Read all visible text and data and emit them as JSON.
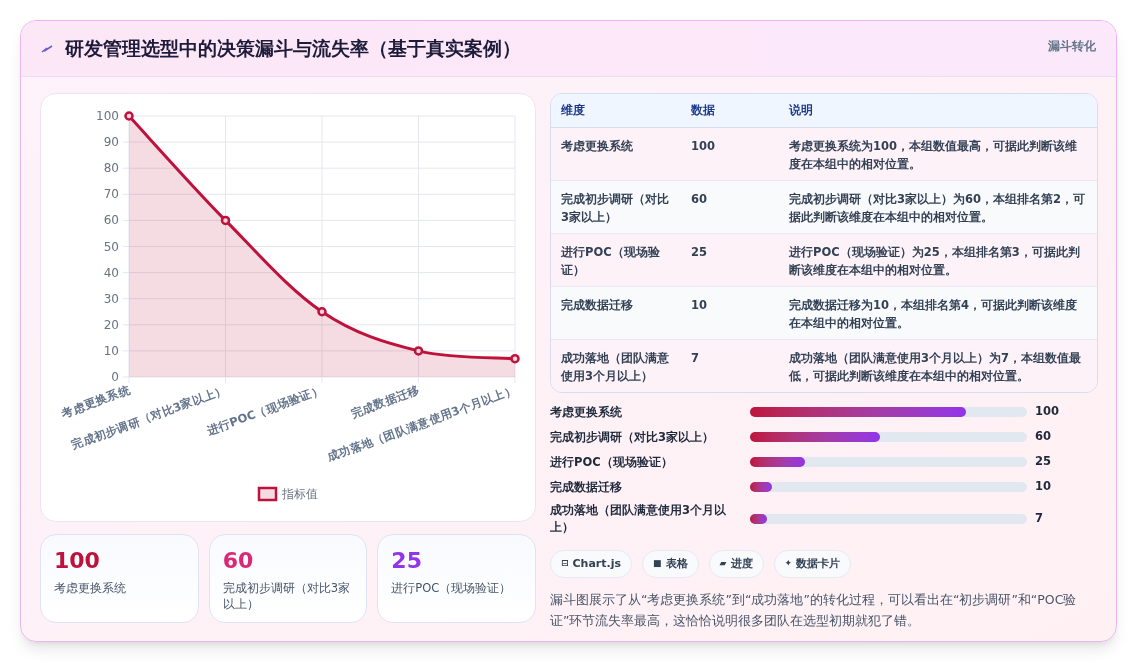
{
  "header": {
    "title": "研发管理选型中的决策漏斗与流失率（基于真实案例）",
    "tag": "漏斗转化"
  },
  "chart": {
    "chart_data": {
      "type": "area",
      "grid": true,
      "categories": [
        "考虑更换系统",
        "完成初步调研（对比3家以上）",
        "进行POC（现场验证）",
        "完成数据迁移",
        "成功落地（团队满意使用3个月以上）"
      ],
      "series": [
        {
          "name": "指标值",
          "color": "#be123c",
          "values": [
            100,
            60,
            25,
            10,
            7
          ]
        }
      ],
      "ylim": [
        0,
        100
      ],
      "yticks": [
        0,
        10,
        20,
        30,
        40,
        50,
        60,
        70,
        80,
        90,
        100
      ]
    }
  },
  "stat_cards": [
    {
      "value": "100",
      "label": "考虑更换系统",
      "color": "#be123c"
    },
    {
      "value": "60",
      "label": "完成初步调研（对比3家以上）",
      "color": "#db2777"
    },
    {
      "value": "25",
      "label": "进行POC（现场验证）",
      "color": "#9333ea"
    }
  ],
  "table": {
    "columns": [
      "维度",
      "数据",
      "说明"
    ],
    "rows": [
      [
        "考虑更换系统",
        "100",
        "考虑更换系统为100，本组数值最高，可据此判断该维度在本组中的相对位置。"
      ],
      [
        "完成初步调研（对比3家以上）",
        "60",
        "完成初步调研（对比3家以上）为60，本组排名第2，可据此判断该维度在本组中的相对位置。"
      ],
      [
        "进行POC（现场验证）",
        "25",
        "进行POC（现场验证）为25，本组排名第3，可据此判断该维度在本组中的相对位置。"
      ],
      [
        "完成数据迁移",
        "10",
        "完成数据迁移为10，本组排名第4，可据此判断该维度在本组中的相对位置。"
      ],
      [
        "成功落地（团队满意使用3个月以上）",
        "7",
        "成功落地（团队满意使用3个月以上）为7，本组数值最低，可据此判断该维度在本组中的相对位置。"
      ]
    ]
  },
  "progress": [
    {
      "label": "考虑更换系统",
      "level": 0.78,
      "reading": "100"
    },
    {
      "label": "完成初步调研（对比3家以上）",
      "level": 0.47,
      "reading": "60"
    },
    {
      "label": "进行POC（现场验证）",
      "level": 0.2,
      "reading": "25"
    },
    {
      "label": "完成数据迁移",
      "level": 0.08,
      "reading": "10"
    },
    {
      "label": "成功落地（团队满意使用3个月以上）",
      "level": 0.06,
      "reading": "7"
    }
  ],
  "chips": [
    {
      "icon": "⊟",
      "label": "Chart.js"
    },
    {
      "icon": "■",
      "label": "表格"
    },
    {
      "icon": "▰",
      "label": "进度"
    },
    {
      "icon": "✦",
      "label": "数据卡片"
    }
  ],
  "summary": "漏斗图展示了从“考虑更换系统”到“成功落地”的转化过程，可以看出在“初步调研”和“POC验证”环节流失率最高，这恰恰说明很多团队在选型初期就犯了错。"
}
